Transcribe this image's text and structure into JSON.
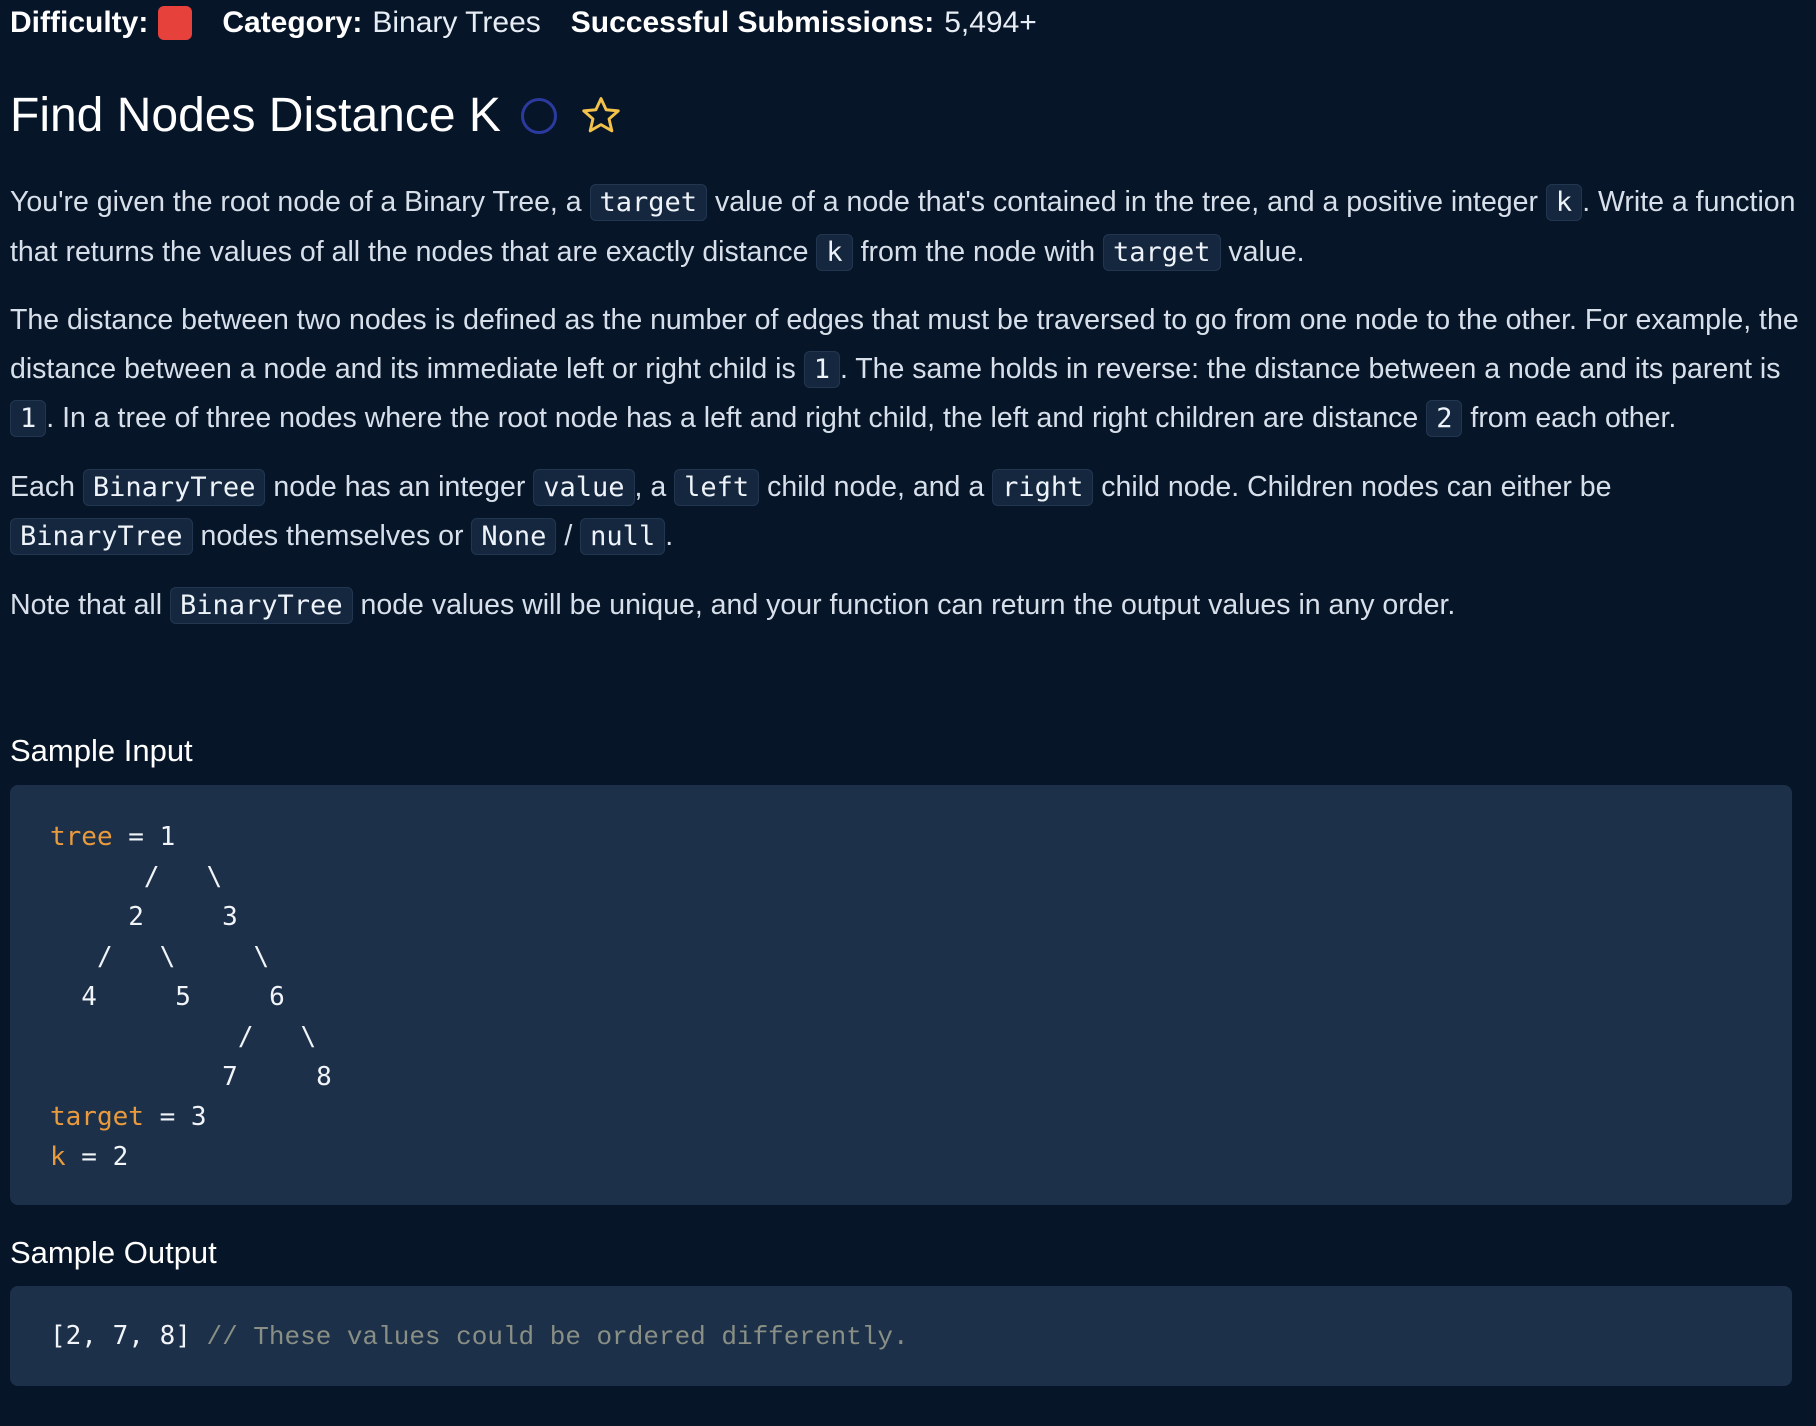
{
  "header": {
    "difficulty_label": "Difficulty:",
    "difficulty_color": "#e6413b",
    "category_label": "Category:",
    "category_value": "Binary Trees",
    "submissions_label": "Successful Submissions:",
    "submissions_value": "5,494+"
  },
  "question": {
    "title": "Find Nodes Distance K",
    "status_icon": "circle-icon",
    "favorite_icon": "star-icon"
  },
  "description": {
    "p1": {
      "t1": "You're given the root node of a Binary Tree, a ",
      "c1": "target",
      "t2": " value of a node that's contained in the tree, and a positive integer ",
      "c2": "k",
      "t3": ". Write a function that returns the values of all the nodes that are exactly distance ",
      "c3": "k",
      "t4": " from the node with ",
      "c4": "target",
      "t5": " value."
    },
    "p2": {
      "t1": "The distance between two nodes is defined as the number of edges that must be traversed to go from one node to the other. For example, the distance between a node and its immediate left or right child is ",
      "c1": "1",
      "t2": ". The same holds in reverse: the distance between a node and its parent is ",
      "c2": "1",
      "t3": ". In a tree of three nodes where the root node has a left and right child, the left and right children are distance ",
      "c3": "2",
      "t4": " from each other."
    },
    "p3": {
      "t1": "Each ",
      "c1": "BinaryTree",
      "t2": " node has an integer ",
      "c2": "value",
      "t3": ", a ",
      "c3": "left",
      "t4": " child node, and a ",
      "c4": "right",
      "t5": " child node. Children nodes can either be ",
      "c5": "BinaryTree",
      "t6": " nodes themselves or ",
      "c6": "None",
      "t7": " / ",
      "c7": "null",
      "t8": "."
    },
    "p4": {
      "t1": "Note that all ",
      "c1": "BinaryTree",
      "t2": " node values will be unique, and your function can return the output values in any order."
    }
  },
  "sample_input": {
    "heading": "Sample Input",
    "tree_key": "tree",
    "tree_line1": " = 1",
    "tree_diagram": "      /   \\\n     2     3\n   /   \\     \\\n  4     5     6\n            /   \\\n           7     8",
    "target_key": "target",
    "target_value": " = 3",
    "k_key": "k",
    "k_value": " = 2",
    "key_color": "#e99a3c"
  },
  "sample_output": {
    "heading": "Sample Output",
    "value": "[2, 7, 8]",
    "comment": " // These values could be ordered differently."
  }
}
